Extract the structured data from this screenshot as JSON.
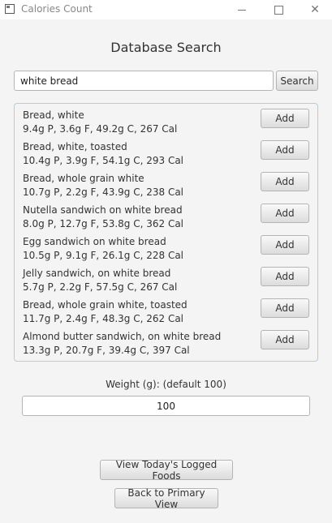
{
  "window": {
    "title": "Calories Count",
    "app_icon": "app-window-icon",
    "controls": [
      "minimize-icon",
      "maximize-icon",
      "close-icon"
    ]
  },
  "heading": "Database Search",
  "search": {
    "value": "white bread",
    "button_label": "Search"
  },
  "results": [
    {
      "name": "Bread, white",
      "macros": "9.4g P, 3.6g F, 49.2g C, 267 Cal",
      "button_label": "Add"
    },
    {
      "name": "Bread, white, toasted",
      "macros": "10.4g P, 3.9g F, 54.1g C, 293 Cal",
      "button_label": "Add"
    },
    {
      "name": "Bread, whole grain white",
      "macros": "10.7g P, 2.2g F, 43.9g C, 238 Cal",
      "button_label": "Add"
    },
    {
      "name": "Nutella sandwich on white bread",
      "macros": "8.0g P, 12.7g F, 53.8g C, 362 Cal",
      "button_label": "Add"
    },
    {
      "name": "Egg sandwich on white bread",
      "macros": "10.5g P, 9.1g F, 26.1g C, 228 Cal",
      "button_label": "Add"
    },
    {
      "name": "Jelly sandwich, on white bread",
      "macros": "5.7g P, 2.2g F, 57.5g C, 267 Cal",
      "button_label": "Add"
    },
    {
      "name": "Bread, whole grain white, toasted",
      "macros": "11.7g P, 2.4g F, 48.3g C, 262 Cal",
      "button_label": "Add"
    },
    {
      "name": "Almond butter sandwich, on white bread",
      "macros": "13.3g P, 20.7g F, 39.4g C, 397 Cal",
      "button_label": "Add"
    }
  ],
  "weight": {
    "label": "Weight (g): (default 100)",
    "value": "100"
  },
  "buttons": {
    "logged_foods": "View Today's Logged Foods",
    "primary_view": "Back to Primary View"
  },
  "colors": {
    "results_border": "#a9d0e4",
    "background": "#f4f4f4"
  }
}
